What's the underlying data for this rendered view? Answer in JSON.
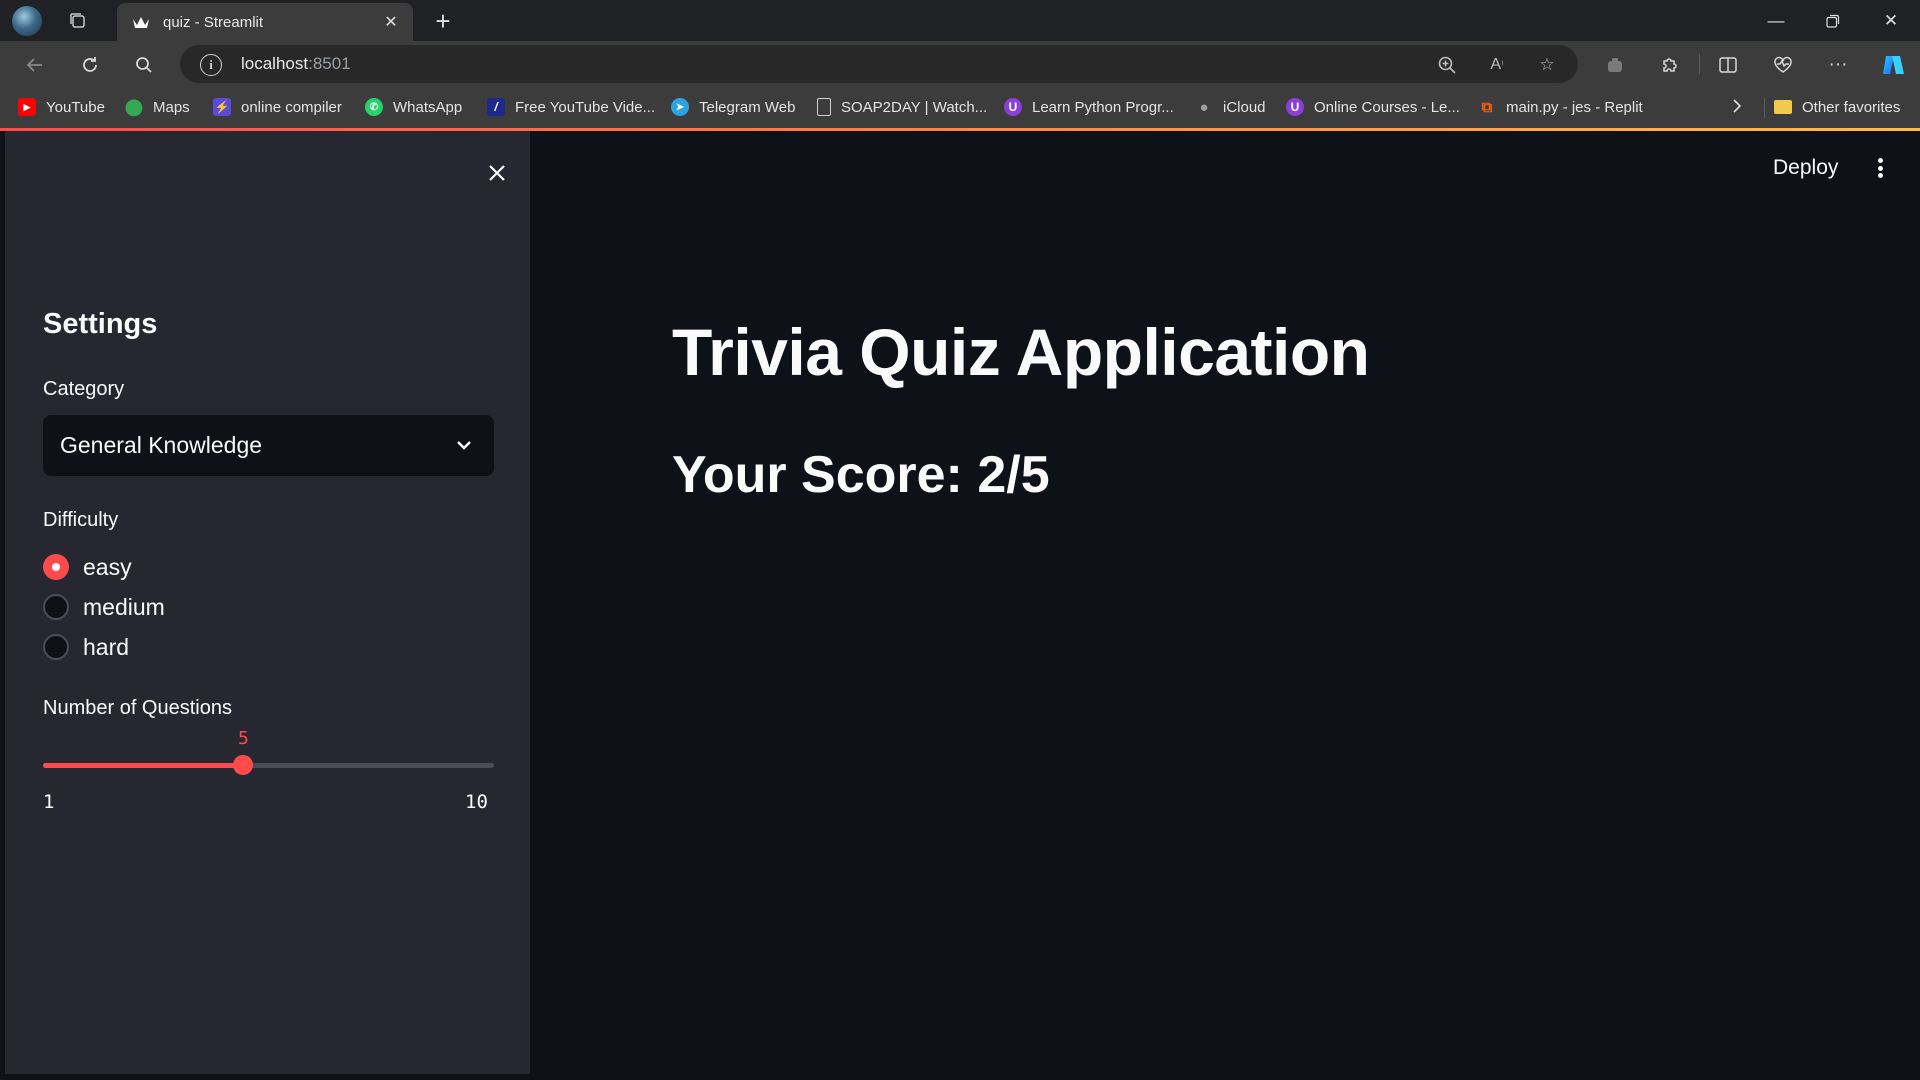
{
  "browser": {
    "tab_title": "quiz - Streamlit",
    "url_host": "localhost",
    "url_port": ":8501",
    "bookmarks": [
      {
        "label": "YouTube",
        "icon": "youtube-icon"
      },
      {
        "label": "Maps",
        "icon": "maps-icon"
      },
      {
        "label": "online compiler",
        "icon": "compiler-icon"
      },
      {
        "label": "WhatsApp",
        "icon": "whatsapp-icon"
      },
      {
        "label": "Free YouTube Vide...",
        "icon": "video-icon"
      },
      {
        "label": "Telegram Web",
        "icon": "telegram-icon"
      },
      {
        "label": "SOAP2DAY | Watch...",
        "icon": "page-icon"
      },
      {
        "label": "Learn Python Progr...",
        "icon": "course-icon"
      },
      {
        "label": "iCloud",
        "icon": "apple-icon"
      },
      {
        "label": "Online Courses - Le...",
        "icon": "course-icon"
      },
      {
        "label": "main.py - jes - Replit",
        "icon": "replit-icon"
      }
    ],
    "other_favorites": "Other favorites"
  },
  "sidebar": {
    "heading": "Settings",
    "category_label": "Category",
    "category_value": "General Knowledge",
    "difficulty_label": "Difficulty",
    "difficulty_options": [
      "easy",
      "medium",
      "hard"
    ],
    "difficulty_selected": "easy",
    "questions_label": "Number of Questions",
    "questions_value": "5",
    "questions_min": "1",
    "questions_max": "10"
  },
  "main": {
    "deploy_label": "Deploy",
    "title": "Trivia Quiz Application",
    "score_text": "Your Score: 2/5"
  },
  "colors": {
    "primary": "#ff4b4b",
    "background": "#0e1117",
    "sidebar": "#262730",
    "text": "#fafafa"
  }
}
